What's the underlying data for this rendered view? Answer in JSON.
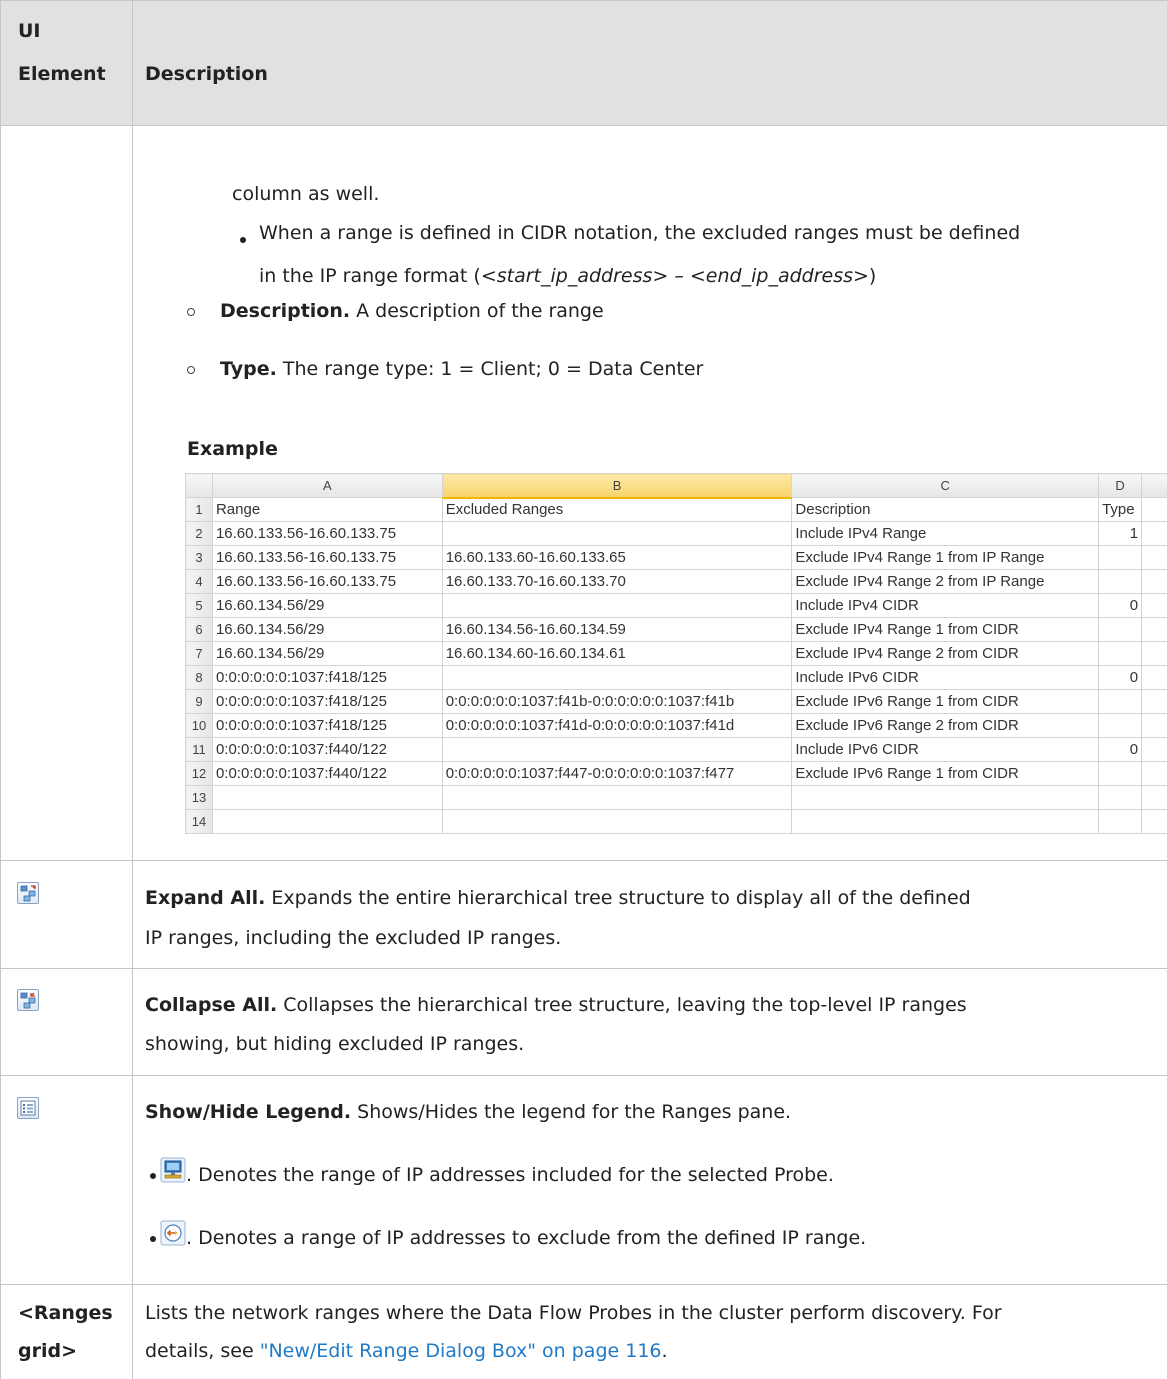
{
  "header": {
    "col1": [
      "UI",
      "Element"
    ],
    "col2": "Description"
  },
  "intro": {
    "cont_line": "column as well.",
    "cidr_bullet_line1": "When a range is defined in CIDR notation, the excluded ranges must be defined",
    "cidr_bullet_line2_pre": "in the IP range format (",
    "cidr_bullet_line2_italic": "<start_ip_address> – <end_ip_address>",
    "cidr_bullet_line2_post": ")",
    "desc_label": "Description.",
    "desc_text": " A description of the range",
    "type_label": "Type.",
    "type_text": " The range type: 1 = Client; 0 = Data Center",
    "example_heading": "Example"
  },
  "sheet": {
    "columns": [
      "A",
      "B",
      "C",
      "D"
    ],
    "rows": [
      [
        "1",
        "Range",
        "Excluded Ranges",
        "Description",
        "Type"
      ],
      [
        "2",
        "16.60.133.56-16.60.133.75",
        "",
        "Include IPv4 Range",
        "1"
      ],
      [
        "3",
        "16.60.133.56-16.60.133.75",
        "16.60.133.60-16.60.133.65",
        "Exclude IPv4 Range 1 from IP Range",
        ""
      ],
      [
        "4",
        "16.60.133.56-16.60.133.75",
        "16.60.133.70-16.60.133.70",
        "Exclude IPv4 Range 2 from IP Range",
        ""
      ],
      [
        "5",
        "16.60.134.56/29",
        "",
        "Include IPv4 CIDR",
        "0"
      ],
      [
        "6",
        "16.60.134.56/29",
        "16.60.134.56-16.60.134.59",
        "Exclude IPv4 Range 1 from CIDR",
        ""
      ],
      [
        "7",
        "16.60.134.56/29",
        "16.60.134.60-16.60.134.61",
        "Exclude IPv4 Range 2 from CIDR",
        ""
      ],
      [
        "8",
        "0:0:0:0:0:0:1037:f418/125",
        "",
        "Include IPv6 CIDR",
        "0"
      ],
      [
        "9",
        "0:0:0:0:0:0:1037:f418/125",
        "0:0:0:0:0:0:1037:f41b-0:0:0:0:0:0:1037:f41b",
        "Exclude IPv6 Range 1 from CIDR",
        ""
      ],
      [
        "10",
        "0:0:0:0:0:0:1037:f418/125",
        "0:0:0:0:0:0:1037:f41d-0:0:0:0:0:0:1037:f41d",
        "Exclude IPv6 Range 2 from CIDR",
        ""
      ],
      [
        "11",
        "0:0:0:0:0:0:1037:f440/122",
        "",
        "Include IPv6 CIDR",
        "0"
      ],
      [
        "12",
        "0:0:0:0:0:0:1037:f440/122",
        "0:0:0:0:0:0:1037:f447-0:0:0:0:0:0:1037:f477",
        "Exclude IPv6 Range 1 from CIDR",
        ""
      ],
      [
        "13",
        "",
        "",
        "",
        ""
      ],
      [
        "14",
        "",
        "",
        "",
        ""
      ]
    ]
  },
  "expand": {
    "icon": "expand-all-icon",
    "label": "Expand All.",
    "text1": " Expands the entire hierarchical tree structure to display all of the defined",
    "text2": "IP ranges, including the excluded IP ranges."
  },
  "collapse": {
    "icon": "collapse-all-icon",
    "label": "Collapse All.",
    "text1": " Collapses the hierarchical tree structure, leaving the top-level IP ranges",
    "text2": "showing, but hiding excluded IP ranges."
  },
  "legend": {
    "icon": "legend-icon",
    "label": "Show/Hide Legend.",
    "text": " Shows/Hides the legend for the Ranges pane.",
    "item1_icon": "probe-range-icon",
    "item1_text": ". Denotes the range of IP addresses included for the selected Probe.",
    "item2_icon": "excluded-range-icon",
    "item2_text": ". Denotes a range of IP addresses to exclude from the defined IP range."
  },
  "grid": {
    "label_line1": "<Ranges",
    "label_line2": "grid>",
    "text1": "Lists the network ranges where the Data Flow Probes in the cluster perform discovery. For",
    "text2_pre": "details, see ",
    "link": "\"New/Edit Range Dialog Box\" on page 116",
    "text2_post": "."
  }
}
